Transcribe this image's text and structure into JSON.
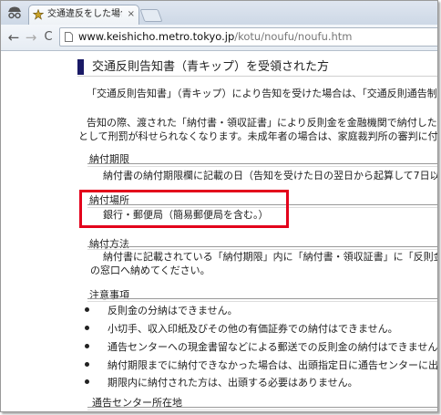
{
  "browser": {
    "tab_title": "交通違反をした場合の反則",
    "tab_close": "×",
    "url_host": "www.keishicho.metro.tokyo.jp",
    "url_path": "/kotu/noufu/noufu.htm",
    "nav_back": "←",
    "nav_forward": "→",
    "nav_reload": "C"
  },
  "page": {
    "title": "交通反則告知書（青キップ）を受領された方",
    "intro_1": "「交通反則告知書」（青キップ）により告知を受けた場合は、「交通反則通告制度」が適用さ",
    "intro_2": "告知の際、渡された「納付書・領収証書」により反則金を金融機関で納付した場合は、刑事",
    "intro_3": "として刑罰が科せられなくなります。未成年者の場合は、家庭裁判所の審判に付されなくなりま",
    "sections": [
      {
        "label": "納付期限",
        "body": "納付書の納付期限欄に記載の日（告知を受けた日の翌日から起算して7日以内）"
      },
      {
        "label": "納付場所",
        "body": "銀行・郵便局（簡易郵便局を含む。）"
      },
      {
        "label": "納付方法",
        "body": "納付書に記載されている「納付期限」内に「納付書・領収証書」に「反則金」を添えて金融",
        "body_2": "の窓口へ納めてください。"
      },
      {
        "label": "注意事項"
      },
      {
        "label": "通告センター所在地"
      }
    ],
    "notes": [
      "反則金の分納はできません。",
      "小切手、収入印紙及びその他の有価証券での納付はできません。",
      "通告センターへの現金書留などによる郵送での反則金の納付はできません。",
      "納付期限までに納付できなかった場合は、出頭指定日に通告センターに出頭してください。",
      "期限内に納付された方は、出頭する必要はありません。"
    ]
  },
  "colors": {
    "highlight": "#e3001b",
    "heading_bar": "#1a1a66"
  }
}
